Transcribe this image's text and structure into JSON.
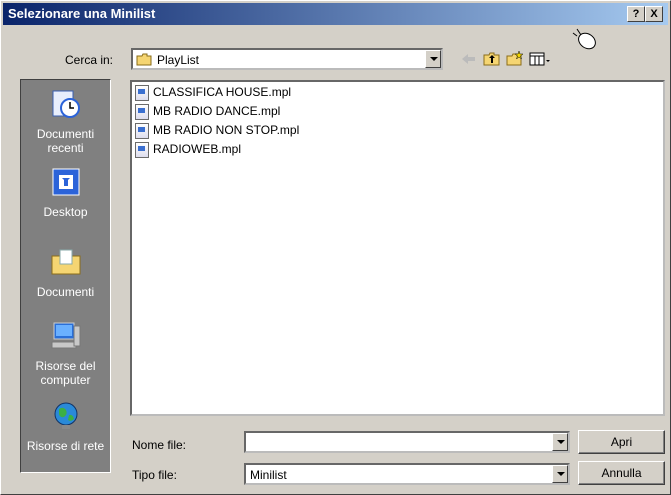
{
  "window": {
    "title": "Selezionare una Minilist",
    "help_label": "?",
    "close_label": "X"
  },
  "lookin": {
    "label": "Cerca in:",
    "value": "PlayList"
  },
  "places": [
    {
      "label": "Documenti recenti"
    },
    {
      "label": "Desktop"
    },
    {
      "label": "Documenti"
    },
    {
      "label": "Risorse del computer"
    },
    {
      "label": "Risorse di rete"
    }
  ],
  "files": [
    "CLASSIFICA HOUSE.mpl",
    "MB RADIO DANCE.mpl",
    "MB RADIO NON STOP.mpl",
    "RADIOWEB.mpl"
  ],
  "filename": {
    "label": "Nome file:",
    "value": ""
  },
  "filetype": {
    "label": "Tipo file:",
    "value": "Minilist"
  },
  "buttons": {
    "open": "Apri",
    "cancel": "Annulla"
  },
  "colors": {
    "title_start": "#0a246a",
    "title_end": "#a6caf0",
    "places_bg": "#808080",
    "face": "#d4d0c8"
  }
}
